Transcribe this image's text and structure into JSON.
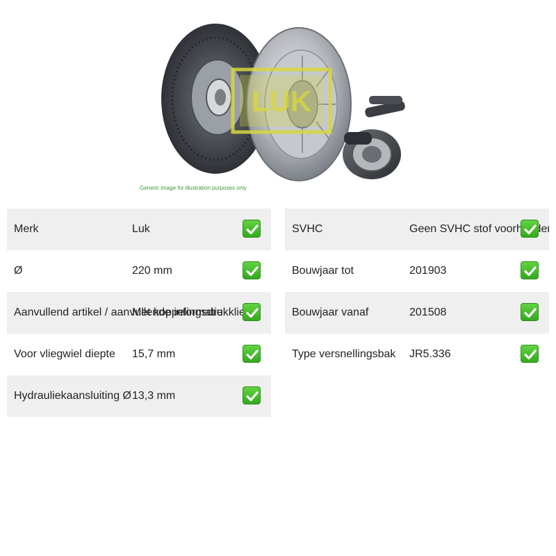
{
  "image": {
    "caption": "Generic image for illustration purposes only",
    "brand_mark": "LUK"
  },
  "left_table": [
    {
      "label": "Merk",
      "value": "Luk",
      "check_icon": "checkmark-icon"
    },
    {
      "label": "Ø",
      "value": "220 mm",
      "check_icon": "checkmark-icon"
    },
    {
      "label": "Aanvullend artikel / aanvullende informatie",
      "value": "Met koppelingsdrukklier",
      "check_icon": "checkmark-icon"
    },
    {
      "label": "Voor vliegwiel diepte",
      "value": "15,7 mm",
      "check_icon": "checkmark-icon"
    },
    {
      "label": "Hydrauliekaansluiting Ø",
      "value": "13,3 mm",
      "check_icon": "checkmark-icon"
    }
  ],
  "right_table": [
    {
      "label": "SVHC",
      "value": "Geen SVHC stof voorhanden",
      "check_icon": "checkmark-icon"
    },
    {
      "label": "Bouwjaar tot",
      "value": "201903",
      "check_icon": "checkmark-icon"
    },
    {
      "label": "Bouwjaar vanaf",
      "value": "201508",
      "check_icon": "checkmark-icon"
    },
    {
      "label": "Type versnellingsbak",
      "value": "JR5.336",
      "check_icon": "checkmark-icon"
    }
  ],
  "colors": {
    "row_shade": "#efefef",
    "check_green": "#3cb521",
    "caption_green": "#3a9a3a",
    "logo_yellow": "#d8d83a"
  }
}
